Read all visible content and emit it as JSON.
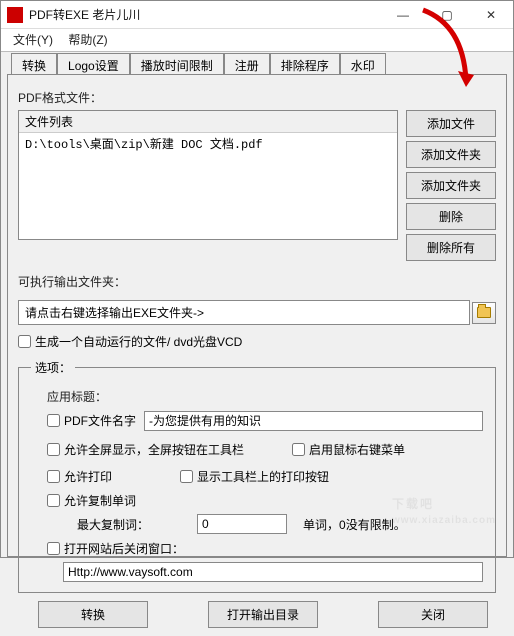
{
  "window": {
    "title": "PDF转EXE   老片儿川"
  },
  "menu": {
    "file": "文件(Y)",
    "help": "帮助(Z)"
  },
  "tabs": {
    "t0": "转换",
    "t1": "Logo设置",
    "t2": "播放时间限制",
    "t3": "注册",
    "t4": "排除程序",
    "t5": "水印"
  },
  "labels": {
    "pdf_files": "PDF格式文件：",
    "file_list_header": "文件列表",
    "output_folder": "可执行输出文件夹：",
    "autorun": "生成一个自动运行的文件/ dvd光盘VCD",
    "options_legend": "选项：",
    "app_title": "应用标题：",
    "pdf_name": "PDF文件名字",
    "fullscreen": "允许全屏显示，全屏按钮在工具栏",
    "right_menu": "启用鼠标右键菜单",
    "allow_print": "允许打印",
    "show_print_btn": "显示工具栏上的打印按钮",
    "allow_copy": "允许复制单词",
    "max_copy": "最大复制词：",
    "max_copy_suffix": "单词，0没有限制。",
    "close_after_web": "打开网站后关闭窗口："
  },
  "buttons": {
    "add_file": "添加文件",
    "add_folder": "添加文件夹",
    "add_folder2": "添加文件夹",
    "delete": "删除",
    "delete_all": "删除所有",
    "convert": "转换",
    "open_output": "打开输出目录",
    "close": "关闭"
  },
  "values": {
    "file_row_0": "D:\\tools\\桌面\\zip\\新建 DOC 文档.pdf",
    "output_path": "请点击右键选择输出EXE文件夹->",
    "app_title_value": "-为您提供有用的知识",
    "max_copy_value": "0",
    "website": "Http://www.vaysoft.com"
  },
  "watermark": {
    "big": "下载吧",
    "small": "www.xiazaiba.com"
  }
}
